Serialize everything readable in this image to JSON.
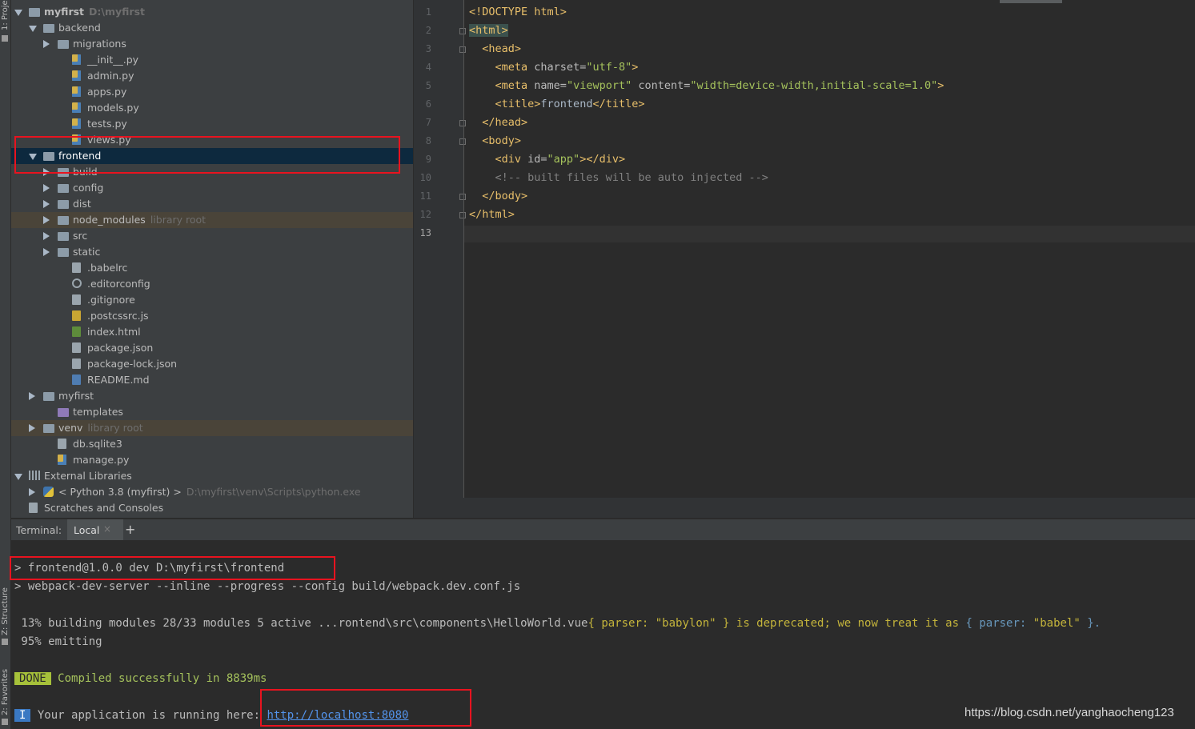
{
  "sidebar_tabs": {
    "project": "1: Project",
    "structure": "Z: Structure",
    "favorites": "2: Favorites"
  },
  "tree": [
    {
      "label": "myfirst",
      "sub": "D:\\myfirst",
      "depth": 0,
      "arrow": "open",
      "icon": "folder",
      "bold": true
    },
    {
      "label": "backend",
      "depth": 1,
      "arrow": "open",
      "icon": "folder"
    },
    {
      "label": "migrations",
      "depth": 2,
      "arrow": "closed",
      "icon": "folder"
    },
    {
      "label": "__init__.py",
      "depth": 3,
      "icon": "py"
    },
    {
      "label": "admin.py",
      "depth": 3,
      "icon": "py"
    },
    {
      "label": "apps.py",
      "depth": 3,
      "icon": "py"
    },
    {
      "label": "models.py",
      "depth": 3,
      "icon": "py"
    },
    {
      "label": "tests.py",
      "depth": 3,
      "icon": "py"
    },
    {
      "label": "views.py",
      "depth": 3,
      "icon": "py"
    },
    {
      "label": "frontend",
      "depth": 1,
      "arrow": "open",
      "icon": "folder",
      "selected": true
    },
    {
      "label": "build",
      "depth": 2,
      "arrow": "closed",
      "icon": "folder"
    },
    {
      "label": "config",
      "depth": 2,
      "arrow": "closed",
      "icon": "folder"
    },
    {
      "label": "dist",
      "depth": 2,
      "arrow": "closed",
      "icon": "folder"
    },
    {
      "label": "node_modules",
      "sub": "library root",
      "depth": 2,
      "arrow": "closed",
      "icon": "folder",
      "library": true
    },
    {
      "label": "src",
      "depth": 2,
      "arrow": "closed",
      "icon": "folder"
    },
    {
      "label": "static",
      "depth": 2,
      "arrow": "closed",
      "icon": "folder"
    },
    {
      "label": ".babelrc",
      "depth": 3,
      "icon": "file"
    },
    {
      "label": ".editorconfig",
      "depth": 3,
      "icon": "gear"
    },
    {
      "label": ".gitignore",
      "depth": 3,
      "icon": "file"
    },
    {
      "label": ".postcssrc.js",
      "depth": 3,
      "icon": "js"
    },
    {
      "label": "index.html",
      "depth": 3,
      "icon": "html"
    },
    {
      "label": "package.json",
      "depth": 3,
      "icon": "file"
    },
    {
      "label": "package-lock.json",
      "depth": 3,
      "icon": "file"
    },
    {
      "label": "README.md",
      "depth": 3,
      "icon": "md"
    },
    {
      "label": "myfirst",
      "depth": 1,
      "arrow": "closed",
      "icon": "folder"
    },
    {
      "label": "templates",
      "depth": 2,
      "icon": "folder-purple"
    },
    {
      "label": "venv",
      "sub": "library root",
      "depth": 1,
      "arrow": "closed",
      "icon": "folder",
      "library": true
    },
    {
      "label": "db.sqlite3",
      "depth": 2,
      "icon": "file"
    },
    {
      "label": "manage.py",
      "depth": 2,
      "icon": "py"
    },
    {
      "label": "External Libraries",
      "depth": 0,
      "arrow": "open",
      "icon": "lib"
    },
    {
      "label": "< Python 3.8 (myfirst) >",
      "sub": "D:\\myfirst\\venv\\Scripts\\python.exe",
      "depth": 1,
      "arrow": "closed",
      "icon": "python"
    },
    {
      "label": "Scratches and Consoles",
      "depth": 0,
      "icon": "scratch"
    }
  ],
  "editor": {
    "line_numbers": [
      "1",
      "2",
      "3",
      "4",
      "5",
      "6",
      "7",
      "8",
      "9",
      "10",
      "11",
      "12",
      "13"
    ],
    "current_line": "13"
  },
  "terminal": {
    "title": "Terminal:",
    "tab_label": "Local",
    "tab_close": "×",
    "add_label": "+",
    "line1": "> frontend@1.0.0 dev D:\\myfirst\\frontend",
    "line2": "> webpack-dev-server --inline --progress --config build/webpack.dev.conf.js",
    "line3a": " 13% building modules 28/33 modules 5 active ...rontend\\src\\components\\HelloWorld.vue",
    "line3b": "{ ",
    "line3c": "parser: ",
    "line3d": "\"babylon\"",
    "line3e": " } is deprecated; we now treat it as ",
    "line3f": "{ parser: ",
    "line3g": "\"babel\"",
    "line3h": " }.",
    "line4": " 95% emitting",
    "done_badge": "DONE",
    "done_text": "Compiled successfully in 8839ms",
    "info_badge": "I",
    "running_text": "Your application is running here: ",
    "url": "http://localhost:8080"
  },
  "watermark": "https://blog.csdn.net/yanghaocheng123",
  "annotation_color": "#e8131f"
}
